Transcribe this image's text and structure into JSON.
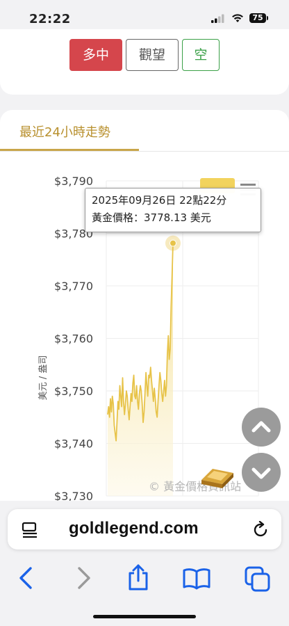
{
  "status_bar": {
    "time": "22:22",
    "battery": "75"
  },
  "signal_buttons": {
    "long": "多中",
    "watch": "觀望",
    "short": "空"
  },
  "tab": {
    "title": "最近24小時走勢"
  },
  "chart_data": {
    "type": "area",
    "ylabel": "美元 / 盎司",
    "ylim": [
      3730,
      3790
    ],
    "y_ticks": [
      "$3,790",
      "$3,780",
      "$3,770",
      "$3,760",
      "$3,750",
      "$3,740",
      "$3,730"
    ],
    "y_tick_values": [
      3790,
      3780,
      3770,
      3760,
      3750,
      3740,
      3730
    ],
    "x_ticks": [],
    "series": [
      {
        "values": [
          3745.5,
          3747.0,
          3745.0,
          3748.5,
          3746.0,
          3749.0,
          3747.5,
          3743.5,
          3742.0,
          3740.5,
          3744.0,
          3748.0,
          3746.5,
          3751.0,
          3749.0,
          3747.0,
          3752.5,
          3748.0,
          3745.5,
          3747.5,
          3750.0,
          3749.0,
          3746.5,
          3744.5,
          3747.0,
          3749.5,
          3748.0,
          3751.5,
          3753.0,
          3749.0,
          3748.5,
          3751.0,
          3748.0,
          3746.5,
          3749.5,
          3751.0,
          3750.0,
          3747.5,
          3744.0,
          3746.0,
          3749.5,
          3753.5,
          3751.0,
          3749.0,
          3753.0,
          3752.5,
          3754.5,
          3752.0,
          3750.0,
          3748.0,
          3750.5,
          3748.5,
          3746.0,
          3745.0,
          3748.0,
          3751.0,
          3753.5,
          3752.0,
          3749.5,
          3748.0,
          3750.0,
          3752.0,
          3749.0,
          3751.0,
          3757.0,
          3760.5,
          3756.0,
          3758.0,
          3766.0,
          3772.0,
          3778.13
        ]
      }
    ],
    "tooltip": {
      "datetime": "2025年09月26日 22點22分",
      "label": "黃金價格：3778.13 美元"
    },
    "colors": {
      "line": "#e7c349",
      "fill_top": "#f3dd8a",
      "fill_bottom": "#fdf8e6",
      "marker": "#e7c349"
    }
  },
  "watermark": "© 黃金價格資訊站",
  "browser": {
    "url": "goldlegend.com"
  },
  "icons": [
    "signal-icon",
    "wifi-icon",
    "battery-icon",
    "chart-menu-icon",
    "scroll-up-icon",
    "scroll-down-icon",
    "reader-icon",
    "reload-icon",
    "back-icon",
    "forward-icon",
    "share-icon",
    "bookmarks-icon",
    "tabs-icon"
  ]
}
